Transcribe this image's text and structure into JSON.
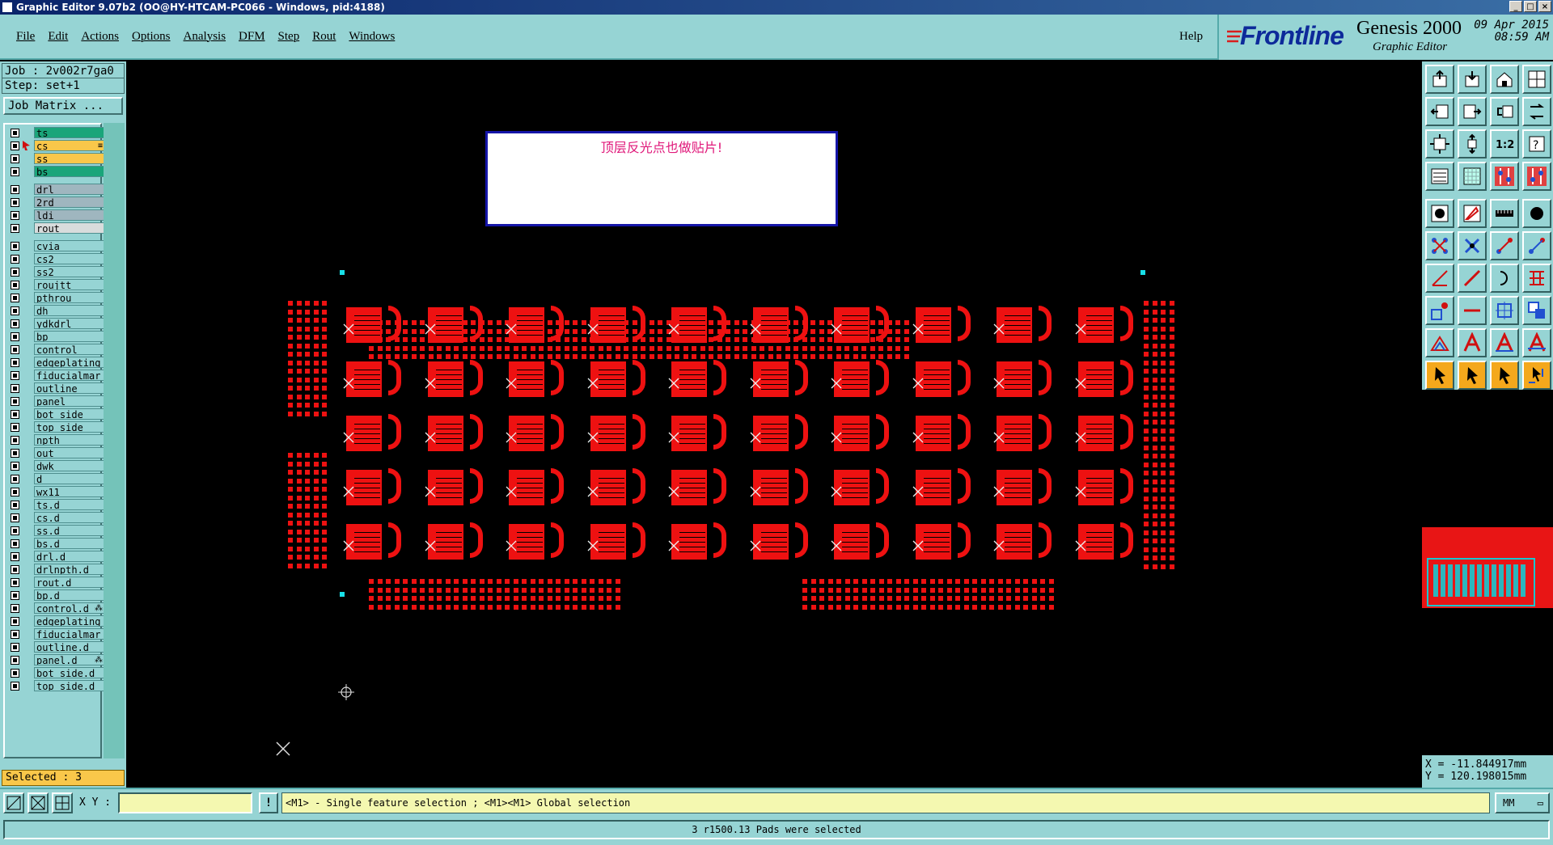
{
  "window": {
    "title": "Graphic Editor 9.07b2 (OO@HY-HTCAM-PC066 - Windows, pid:4188)"
  },
  "menu": [
    "File",
    "Edit",
    "Actions",
    "Options",
    "Analysis",
    "DFM",
    "Step",
    "Rout",
    "Windows"
  ],
  "help_label": "Help",
  "brand": {
    "logo": "Frontline",
    "product": "Genesis 2000",
    "subtitle": "Graphic Editor",
    "date": "09 Apr 2015",
    "time": "08:59 AM"
  },
  "job": {
    "job_label": "Job : 2v002r7ga0",
    "step_label": "Step: set+1",
    "matrix_button": "Job Matrix ..."
  },
  "layers": [
    {
      "name": "ts",
      "color": "#1aa57a",
      "gap": 0
    },
    {
      "name": "cs",
      "color": "#f9c74a",
      "gap": 0,
      "active": true,
      "suffix": "≡"
    },
    {
      "name": "ss",
      "color": "#f9c74a",
      "gap": 0
    },
    {
      "name": "bs",
      "color": "#1aa57a",
      "gap": 0
    },
    {
      "name": "drl",
      "color": "#9fb6bf",
      "gap": 1
    },
    {
      "name": "2rd",
      "color": "#9fb6bf",
      "gap": 0
    },
    {
      "name": "ldi",
      "color": "#9fb6bf",
      "gap": 0
    },
    {
      "name": "rout",
      "color": "#d8dcdc",
      "gap": 0
    },
    {
      "name": "cvia",
      "color": "#96d4d4",
      "gap": 1
    },
    {
      "name": "cs2",
      "color": "#96d4d4",
      "gap": 0
    },
    {
      "name": "ss2",
      "color": "#96d4d4",
      "gap": 0
    },
    {
      "name": "roujtt",
      "color": "#96d4d4",
      "gap": 0
    },
    {
      "name": "pthrou",
      "color": "#96d4d4",
      "gap": 0
    },
    {
      "name": "dh",
      "color": "#96d4d4",
      "gap": 0
    },
    {
      "name": "ydkdrl",
      "color": "#96d4d4",
      "gap": 0
    },
    {
      "name": "bp",
      "color": "#96d4d4",
      "gap": 0
    },
    {
      "name": "control",
      "color": "#96d4d4",
      "gap": 0
    },
    {
      "name": "edgeplating",
      "color": "#96d4d4",
      "gap": 0
    },
    {
      "name": "fiducialmar",
      "color": "#96d4d4",
      "gap": 0
    },
    {
      "name": "outline",
      "color": "#96d4d4",
      "gap": 0
    },
    {
      "name": "panel",
      "color": "#96d4d4",
      "gap": 0
    },
    {
      "name": "bot_side",
      "color": "#96d4d4",
      "gap": 0
    },
    {
      "name": "top_side",
      "color": "#96d4d4",
      "gap": 0
    },
    {
      "name": "npth",
      "color": "#96d4d4",
      "gap": 0
    },
    {
      "name": "out",
      "color": "#96d4d4",
      "gap": 0
    },
    {
      "name": "dwk",
      "color": "#96d4d4",
      "gap": 0
    },
    {
      "name": "d",
      "color": "#96d4d4",
      "gap": 0
    },
    {
      "name": "wx11",
      "color": "#96d4d4",
      "gap": 0
    },
    {
      "name": "ts.d",
      "color": "#96d4d4",
      "gap": 0
    },
    {
      "name": "cs.d",
      "color": "#96d4d4",
      "gap": 0
    },
    {
      "name": "ss.d",
      "color": "#96d4d4",
      "gap": 0
    },
    {
      "name": "bs.d",
      "color": "#96d4d4",
      "gap": 0
    },
    {
      "name": "drl.d",
      "color": "#96d4d4",
      "gap": 0
    },
    {
      "name": "drlnpth.d",
      "color": "#96d4d4",
      "gap": 0
    },
    {
      "name": "rout.d",
      "color": "#96d4d4",
      "gap": 0
    },
    {
      "name": "bp.d",
      "color": "#96d4d4",
      "gap": 0
    },
    {
      "name": "control.d",
      "color": "#96d4d4",
      "gap": 0,
      "suffix": "⁂"
    },
    {
      "name": "edgeplating",
      "color": "#96d4d4",
      "gap": 0
    },
    {
      "name": "fiducialmar",
      "color": "#96d4d4",
      "gap": 0
    },
    {
      "name": "outline.d",
      "color": "#96d4d4",
      "gap": 0
    },
    {
      "name": "panel.d",
      "color": "#96d4d4",
      "gap": 0,
      "suffix": "⁂"
    },
    {
      "name": "bot_side.d",
      "color": "#96d4d4",
      "gap": 0
    },
    {
      "name": "top_side.d",
      "color": "#96d4d4",
      "gap": 0
    }
  ],
  "selected_label": "Selected : 3",
  "canvas": {
    "note_text": "顶层反光点也做贴片!",
    "pad_color": "#ee1111",
    "fiducial_color": "#18e0e8",
    "pad_rows": 5,
    "pad_cols": 10
  },
  "toolbox_icons": [
    "open-icon",
    "save-icon",
    "home-icon",
    "window-layout-icon",
    "zoom-left-icon",
    "zoom-right-icon",
    "undo-zoom-icon",
    "redraw-icon",
    "fit-icon",
    "zoom-fit-icon",
    "scale-1-2-icon",
    "help-icon",
    "snap-icon",
    "grid-icon",
    "layer-compare-icon",
    "layer-swap-icon",
    "add-pad-icon",
    "add-shape-icon",
    "ruler-icon",
    "feature-icon",
    "connect-icon",
    "delete-icon",
    "move-point-icon",
    "move-icon",
    "line-angle-icon",
    "line-icon",
    "arc-icon",
    "fill-icon",
    "polygon-icon",
    "split-icon",
    "measure-icon",
    "copy-icon",
    "triangle-icon",
    "text-a-icon",
    "text-a2-icon",
    "text-a3-icon",
    "select-pointer-icon",
    "select-pointer-2-icon",
    "select-pointer-3-icon",
    "select-net-icon"
  ],
  "coords": {
    "x": "X = -11.844917mm",
    "y": "Y = 120.198015mm"
  },
  "bottom": {
    "xy_label": "X Y :",
    "xy_value": "",
    "info_button": "!",
    "hint": "<M1> - Single feature selection ; <M1><M1> Global selection",
    "unit": "MM",
    "status": "3 r1500.13 Pads were selected"
  }
}
